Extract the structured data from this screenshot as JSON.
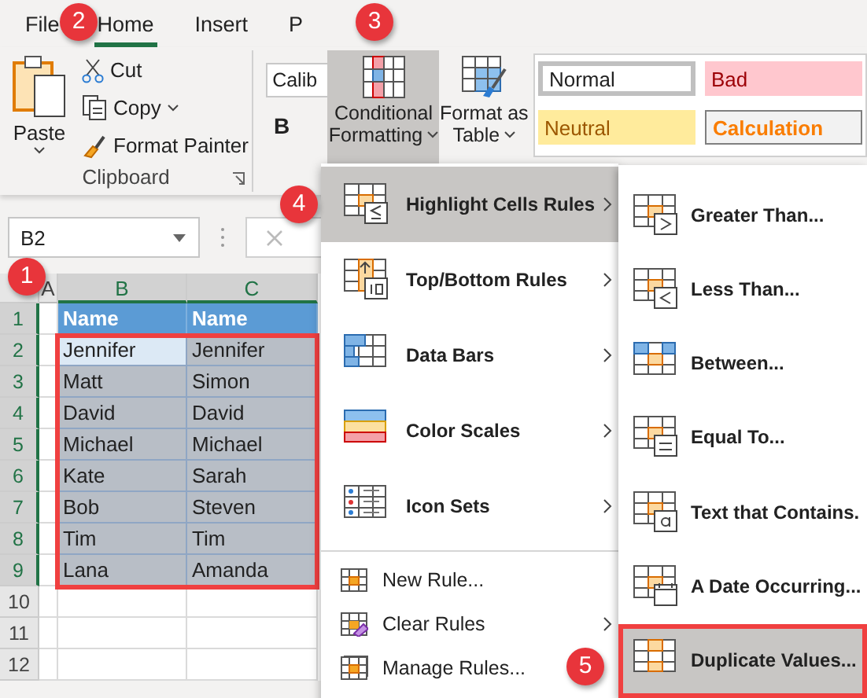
{
  "tabs": [
    {
      "label": "File",
      "selected": false
    },
    {
      "label": "Home",
      "selected": true
    },
    {
      "label": "Insert",
      "selected": false
    },
    {
      "label": "P",
      "selected": false
    }
  ],
  "clipboard": {
    "paste": "Paste",
    "cut": "Cut",
    "copy": "Copy",
    "format_painter": "Format Painter",
    "group_label": "Clipboard"
  },
  "font": {
    "font_name": "Calib",
    "bold": "B"
  },
  "ribbon_buttons": [
    {
      "lines": [
        "Conditional",
        "Formatting"
      ],
      "selected": true
    },
    {
      "lines": [
        "Format as",
        "Table"
      ],
      "selected": false
    }
  ],
  "cell_styles": [
    {
      "label": "Normal",
      "kind": "normal"
    },
    {
      "label": "Bad",
      "kind": "bad"
    },
    {
      "label": "Neutral",
      "kind": "neutral"
    },
    {
      "label": "Calculation",
      "kind": "calculation"
    }
  ],
  "name_box": "B2",
  "sheet": {
    "columns": [
      "A",
      "B",
      "C"
    ],
    "rows": [
      {
        "number": "1",
        "kind": "header",
        "cells": [
          {
            "text": "Name"
          },
          {
            "text": "Name"
          }
        ]
      },
      {
        "number": "2",
        "kind": "data",
        "cells": [
          {
            "text": "Jennifer",
            "active": true
          },
          {
            "text": "Jennifer",
            "active": false
          }
        ]
      },
      {
        "number": "3",
        "kind": "data",
        "cells": [
          {
            "text": "Matt",
            "active": false
          },
          {
            "text": "Simon",
            "active": false
          }
        ]
      },
      {
        "number": "4",
        "kind": "data",
        "cells": [
          {
            "text": "David",
            "active": false
          },
          {
            "text": "David",
            "active": false
          }
        ]
      },
      {
        "number": "5",
        "kind": "data",
        "cells": [
          {
            "text": "Michael",
            "active": false
          },
          {
            "text": "Michael",
            "active": false
          }
        ]
      },
      {
        "number": "6",
        "kind": "data",
        "cells": [
          {
            "text": "Kate",
            "active": false
          },
          {
            "text": "Sarah",
            "active": false
          }
        ]
      },
      {
        "number": "7",
        "kind": "data",
        "cells": [
          {
            "text": "Bob",
            "active": false
          },
          {
            "text": "Steven",
            "active": false
          }
        ]
      },
      {
        "number": "8",
        "kind": "data",
        "cells": [
          {
            "text": "Tim",
            "active": false
          },
          {
            "text": "Tim",
            "active": false
          }
        ]
      },
      {
        "number": "9",
        "kind": "data",
        "cells": [
          {
            "text": "Lana",
            "active": false
          },
          {
            "text": "Amanda",
            "active": false
          }
        ]
      },
      {
        "number": "10",
        "kind": "empty",
        "cells": []
      },
      {
        "number": "11",
        "kind": "empty",
        "cells": []
      },
      {
        "number": "12",
        "kind": "empty",
        "cells": []
      }
    ]
  },
  "menu": {
    "items": [
      {
        "label": "Highlight Cells Rules",
        "kind": "large",
        "selected": true,
        "submenu": true
      },
      {
        "label": "Top/Bottom Rules",
        "kind": "large",
        "selected": false,
        "submenu": true
      },
      {
        "label": "Data Bars",
        "kind": "large",
        "selected": false,
        "submenu": true
      },
      {
        "label": "Color Scales",
        "kind": "large",
        "selected": false,
        "submenu": true
      },
      {
        "label": "Icon Sets",
        "kind": "large",
        "selected": false,
        "submenu": true
      },
      {
        "label": "New Rule...",
        "kind": "small",
        "selected": false,
        "submenu": false
      },
      {
        "label": "Clear Rules",
        "kind": "small",
        "selected": false,
        "submenu": true
      },
      {
        "label": "Manage Rules...",
        "kind": "small",
        "selected": false,
        "submenu": false
      }
    ]
  },
  "submenu": {
    "items": [
      {
        "label": "Greater Than...",
        "selected": false
      },
      {
        "label": "Less Than...",
        "selected": false
      },
      {
        "label": "Between...",
        "selected": false
      },
      {
        "label": "Equal To...",
        "selected": false
      },
      {
        "label": "Text that Contains.",
        "selected": false
      },
      {
        "label": "A Date Occurring...",
        "selected": false
      },
      {
        "label": "Duplicate Values...",
        "selected": true
      }
    ]
  },
  "callouts": [
    "1",
    "2",
    "3",
    "4",
    "5"
  ]
}
